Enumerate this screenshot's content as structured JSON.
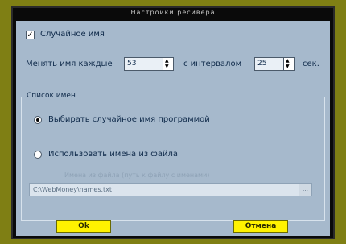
{
  "window": {
    "title": "Настройки ресивера"
  },
  "options": {
    "random_names_checkbox_checked": true,
    "random_names_label": "Случайное имя",
    "change_every_label": "Менять имя каждые",
    "change_every_value": "53",
    "interval_label": "с интервалом",
    "interval_value": "25",
    "seconds_label": "сек."
  },
  "names_list": {
    "group_title": "Список имен",
    "option_random": "Выбирать случайное имя программой",
    "option_file": "Использовать имена из файла",
    "file_hint": "Имена из файла (путь к файлу с именами)",
    "file_path": "C:\\WebMoney\\names.txt",
    "selected": "random"
  },
  "footer": {
    "ok_label": "Ok",
    "cancel_label": "Отмена"
  },
  "colors": {
    "panel": "#a6b9cc",
    "button": "#fff200",
    "frame": "#7f7f14"
  }
}
